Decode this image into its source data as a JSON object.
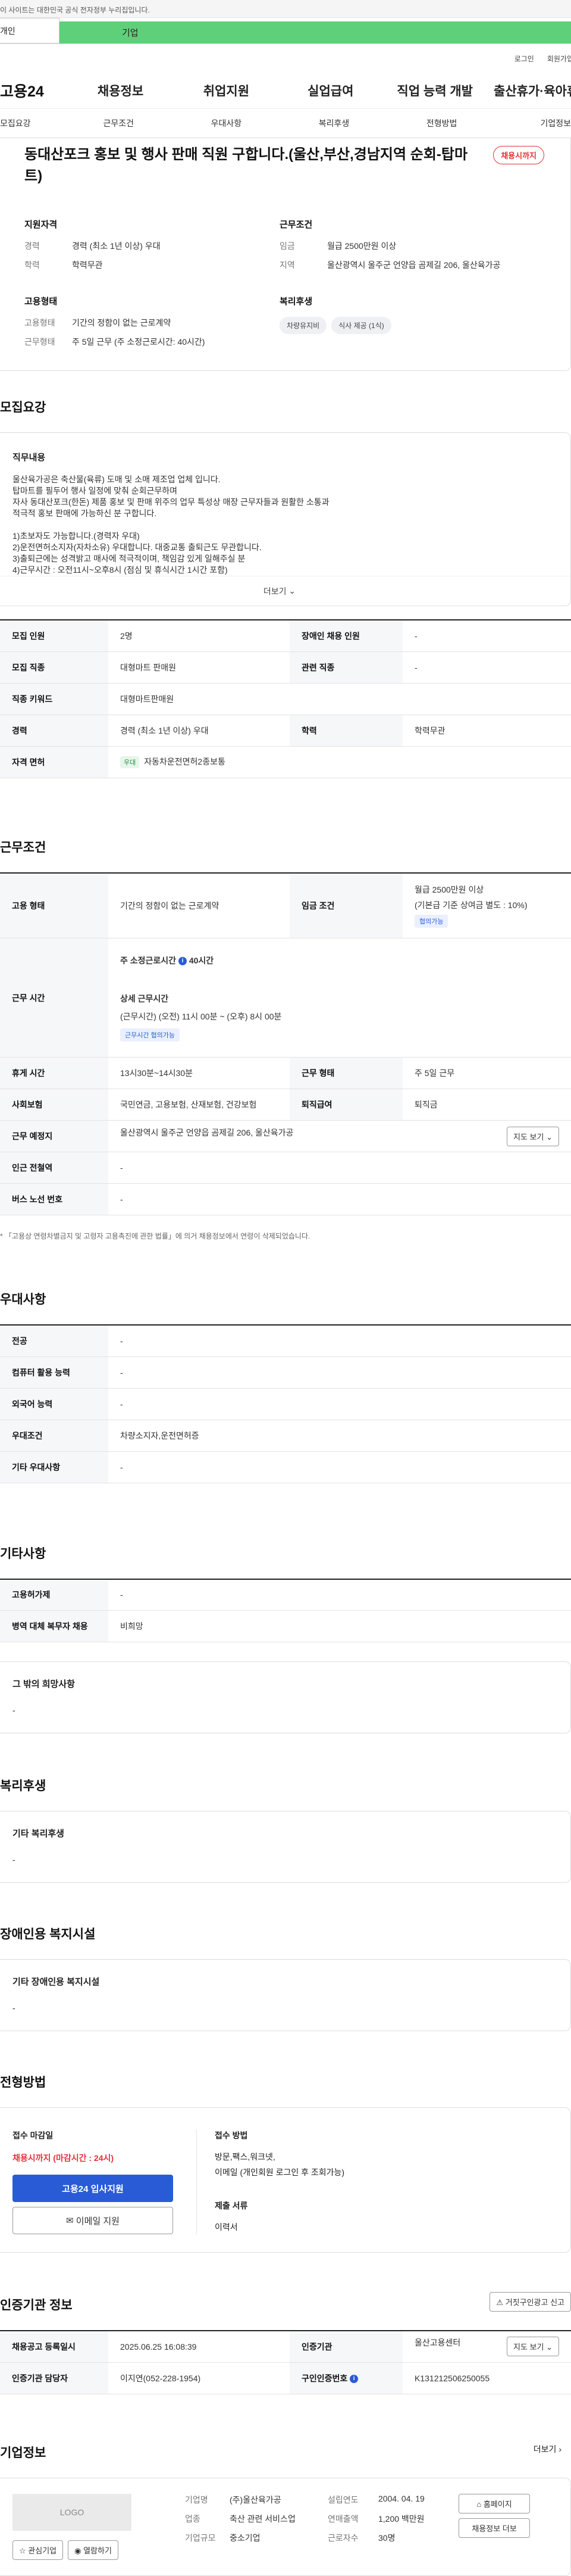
{
  "gov_notice": "이 사이트는 대한민국 공식 전자정부 누리집입니다.",
  "top_tabs": [
    "개인",
    "기업"
  ],
  "util_links": [
    "로그인",
    "회원가입"
  ],
  "logo": "고용24",
  "gnb": [
    "채용정보",
    "취업지원",
    "실업급여",
    "직업 능력 개발",
    "출산휴가·육아휴직"
  ],
  "subnav": [
    "모집요강",
    "근무조건",
    "우대사항",
    "복리후생",
    "전형방법",
    "기업정보"
  ],
  "job": {
    "title": "동대산포크 홍보 및 행사 판매 직원 구합니다.(울산,부산,경남지역 순회-탑마트)",
    "badge": "채용시까지"
  },
  "summary": {
    "qual_title": "지원자격",
    "career_k": "경력",
    "career_v": "경력 (최소 1년 이상) 우대",
    "edu_k": "학력",
    "edu_v": "학력무관",
    "cond_title": "근무조건",
    "wage_k": "임금",
    "wage_v": "월급 2500만원 이상",
    "loc_k": "지역",
    "loc_v": "울산광역시 울주군 언양읍 곰제길 206, 울산육가공",
    "emp_title": "고용형태",
    "emptype_k": "고용형태",
    "emptype_v": "기간의 정함이 없는 근로계약",
    "worktype_k": "근무형태",
    "worktype_v": "주 5일 근무 (주 소정근로시간: 40시간)",
    "welfare_title": "복리후생",
    "welfare_chips": [
      "차량유지비",
      "식사 제공 (1식)"
    ]
  },
  "recruit": {
    "section": "모집요강",
    "duty_title": "직무내용",
    "duty_text": "울산육가공은 축산물(육류) 도매 및 소매 제조업 업체 입니다.\n탑마트를 필두어 행사 일정에 맞춰 순회근무하며\n자사 동대산포크(한돈) 제품 홍보 및 판매 위주의 업무 특성상 매장 근무자들과 원활한 소통과\n적극적 홍보 판매에 가능하신 분 구합니다.\n\n1)초보자도 가능합니다.(경력자 우대)\n2)운전면허소지자(자차소유) 우대합니다. 대중교통 출퇴근도 무관합니다.\n3)출퇴근에는 성격밝고 매사에 적극적이며, 책임감 있게 일해주실 분\n4)근무시간 : 오전11시~오후8시 (점심 및 휴식시간 1시간 포함)",
    "more": "더보기",
    "rows": {
      "count_k": "모집 인원",
      "count_v": "2명",
      "disabled_k": "장애인 채용 인원",
      "disabled_v": "-",
      "job_k": "모집 직종",
      "job_v": "대형마트 판매원",
      "rel_k": "관련 직종",
      "rel_v": "-",
      "kw_k": "직종 키워드",
      "kw_v": "대형마트판매원",
      "career_k": "경력",
      "career_v": "경력 (최소 1년 이상) 우대",
      "edu_k": "학력",
      "edu_v": "학력무관",
      "lic_k": "자격 면허",
      "lic_chip": "우대",
      "lic_v": "자동차운전면허2종보통"
    }
  },
  "conditions": {
    "section": "근무조건",
    "emptype_k": "고용 형태",
    "emptype_v": "기간의 정함이 없는 근로계약",
    "wage_k": "임금 조건",
    "wage_v1": "월급 2500만원 이상",
    "wage_v2": "(기본급 기준 상여금 별도 : 10%)",
    "wage_chip": "협의가능",
    "time_k": "근무 시간",
    "time_total": "주 소정근로시간",
    "time_hours": "40시간",
    "time_detail_title": "상세 근무시간",
    "time_detail": "(근무시간) (오전) 11시 00분 ~ (오후) 8시 00분",
    "time_chip": "근무시간 협의가능",
    "break_k": "휴게 시간",
    "break_v": "13시30분~14시30분",
    "worktype_k": "근무 형태",
    "worktype_v": "주 5일 근무",
    "ins_k": "사회보험",
    "ins_v": "국민연금, 고용보험, 산재보험, 건강보험",
    "sev_k": "퇴직급여",
    "sev_v": "퇴직금",
    "place_k": "근무 예정지",
    "place_v": "울산광역시 울주군 언양읍 곰제길 206, 울산육가공",
    "map_btn": "지도 보기",
    "subway_k": "인근 전철역",
    "subway_v": "-",
    "bus_k": "버스 노선 번호",
    "bus_v": "-",
    "note": "* 「고용상 연령차별금지 및 고령자 고용촉진에 관한 법률」에 의거 채용정보에서 연령이 삭제되었습니다."
  },
  "pref": {
    "section": "우대사항",
    "major_k": "전공",
    "major_v": "-",
    "pc_k": "컴퓨터 활용 능력",
    "pc_v": "-",
    "lang_k": "외국어 능력",
    "lang_v": "-",
    "cond_k": "우대조건",
    "cond_v": "차량소지자,운전면허증",
    "etc_k": "기타 우대사항",
    "etc_v": "-"
  },
  "other": {
    "section": "기타사항",
    "ins_k": "고용허가제",
    "ins_v": "-",
    "mil_k": "병역 대체 복무자 채용",
    "mil_v": "비희망",
    "hope_title": "그 밖의 희망사항",
    "hope_v": "-"
  },
  "welfare": {
    "section": "복리후생",
    "title": "기타 복리후생",
    "v": "-"
  },
  "disabled": {
    "section": "장애인용 복지시설",
    "title": "기타 장애인용 복지시설",
    "v": "-"
  },
  "process": {
    "section": "전형방법",
    "deadline_title": "접수 마감일",
    "deadline_v": "채용시까지 (마감시간 : 24시)",
    "apply_btn": "고용24 입사지원",
    "email_btn": "이메일 지원",
    "method_title": "접수 방법",
    "method_v1": "방문,팩스,워크넷,",
    "method_v2": "이메일 (개인회원 로그인 후 조회가능)",
    "docs_title": "제출 서류",
    "docs_v": "이력서"
  },
  "agency": {
    "section": "인증기관 정보",
    "report_btn": "거짓구인광고 신고",
    "reg_k": "채용공고 등록일시",
    "reg_v": "2025.06.25 16:08:39",
    "org_k": "인증기관",
    "org_v": "울산고용센터",
    "map_btn": "지도 보기",
    "mgr_k": "인증기관 담당자",
    "mgr_v": "이지연(052-228-1954)",
    "id_k": "구인인증번호",
    "id_v": "K131212506250055"
  },
  "company": {
    "section": "기업정보",
    "more": "더보기",
    "logo": "LOGO",
    "fav_btn": "관심기업",
    "follow_btn": "열람하기",
    "name_k": "기업명",
    "name_v": "(주)울산육가공",
    "ind_k": "업종",
    "ind_v": "축산 관련 서비스업",
    "size_k": "기업규모",
    "size_v": "중소기업",
    "est_k": "설립연도",
    "est_v": "2004. 04. 19",
    "rev_k": "연매출액",
    "rev_v": "1,200 백만원",
    "emp_k": "근로자수",
    "emp_v": "30명",
    "home_btn": "홈페이지",
    "info_btn": "채용정보 더보"
  }
}
